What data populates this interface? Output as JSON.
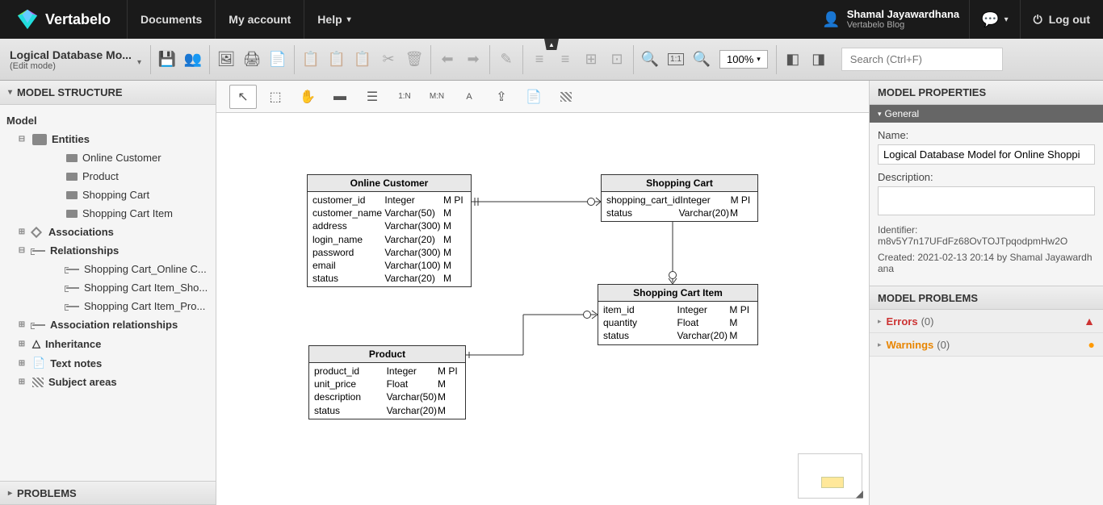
{
  "header": {
    "brand": "Vertabelo",
    "nav": {
      "documents": "Documents",
      "my_account": "My account",
      "help": "Help"
    },
    "user": {
      "name": "Shamal Jayawardhana",
      "sub": "Vertabelo Blog"
    },
    "logout": "Log out"
  },
  "doc": {
    "title": "Logical Database Mo...",
    "mode": "(Edit mode)"
  },
  "zoom": "100%",
  "search": {
    "placeholder": "Search (Ctrl+F)"
  },
  "left_panel": {
    "structure_title": "MODEL STRUCTURE",
    "problems_title": "PROBLEMS",
    "root": "Model",
    "entities_label": "Entities",
    "entities": [
      "Online Customer",
      "Product",
      "Shopping Cart",
      "Shopping Cart Item"
    ],
    "associations_label": "Associations",
    "relationships_label": "Relationships",
    "relationships": [
      "Shopping Cart_Online C...",
      "Shopping Cart Item_Sho...",
      "Shopping Cart Item_Pro..."
    ],
    "assoc_rel_label": "Association relationships",
    "inheritance_label": "Inheritance",
    "text_notes_label": "Text notes",
    "subject_areas_label": "Subject areas"
  },
  "entities": {
    "online_customer": {
      "title": "Online Customer",
      "rows": [
        {
          "n": "customer_id",
          "t": "Integer",
          "f": "M PI"
        },
        {
          "n": "customer_name",
          "t": "Varchar(50)",
          "f": "M"
        },
        {
          "n": "address",
          "t": "Varchar(300)",
          "f": "M"
        },
        {
          "n": "login_name",
          "t": "Varchar(20)",
          "f": "M"
        },
        {
          "n": "password",
          "t": "Varchar(300)",
          "f": "M"
        },
        {
          "n": "email",
          "t": "Varchar(100)",
          "f": "M"
        },
        {
          "n": "status",
          "t": "Varchar(20)",
          "f": "M"
        }
      ]
    },
    "shopping_cart": {
      "title": "Shopping Cart",
      "rows": [
        {
          "n": "shopping_cart_id",
          "t": "Integer",
          "f": "M PI"
        },
        {
          "n": "status",
          "t": "Varchar(20)",
          "f": "M"
        }
      ]
    },
    "shopping_cart_item": {
      "title": "Shopping Cart Item",
      "rows": [
        {
          "n": "item_id",
          "t": "Integer",
          "f": "M PI"
        },
        {
          "n": "quantity",
          "t": "Float",
          "f": "M"
        },
        {
          "n": "status",
          "t": "Varchar(20)",
          "f": "M"
        }
      ]
    },
    "product": {
      "title": "Product",
      "rows": [
        {
          "n": "product_id",
          "t": "Integer",
          "f": "M PI"
        },
        {
          "n": "unit_price",
          "t": "Float",
          "f": "M"
        },
        {
          "n": "description",
          "t": "Varchar(50)",
          "f": "M"
        },
        {
          "n": "status",
          "t": "Varchar(20)",
          "f": "M"
        }
      ]
    }
  },
  "right_panel": {
    "properties_title": "MODEL PROPERTIES",
    "general_title": "General",
    "name_label": "Name:",
    "name_value": "Logical Database Model for Online Shoppi",
    "desc_label": "Description:",
    "identifier_label": "Identifier:",
    "identifier_value": "m8v5Y7n17UFdFz68OvTOJTpqodpmHw2O",
    "created_label": "Created: 2021-02-13 20:14 by Shamal Jayawardhana",
    "problems_title": "MODEL PROBLEMS",
    "errors_label": "Errors",
    "errors_count": "(0)",
    "warnings_label": "Warnings",
    "warnings_count": "(0)"
  }
}
